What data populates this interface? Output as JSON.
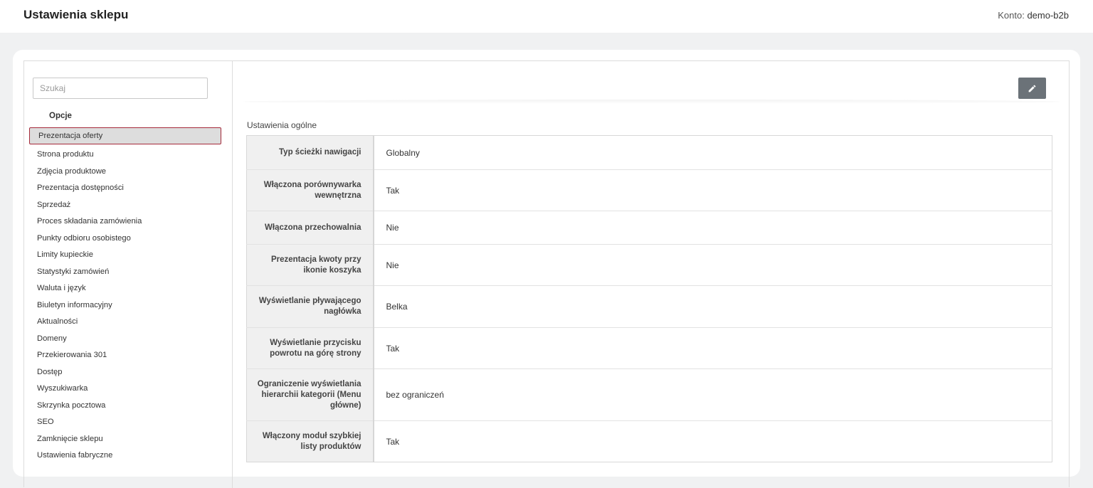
{
  "header": {
    "title": "Ustawienia sklepu",
    "account_label": "Konto:",
    "account_name": "demo-b2b"
  },
  "sidebar": {
    "search_placeholder": "Szukaj",
    "heading": "Opcje",
    "items": [
      {
        "label": "Prezentacja oferty",
        "active": true
      },
      {
        "label": "Strona produktu"
      },
      {
        "label": "Zdjęcia produktowe"
      },
      {
        "label": "Prezentacja dostępności"
      },
      {
        "label": "Sprzedaż"
      },
      {
        "label": "Proces składania zamówienia"
      },
      {
        "label": "Punkty odbioru osobistego"
      },
      {
        "label": "Limity kupieckie"
      },
      {
        "label": "Statystyki zamówień"
      },
      {
        "label": "Waluta i język"
      },
      {
        "label": "Biuletyn informacyjny"
      },
      {
        "label": "Aktualności"
      },
      {
        "label": "Domeny"
      },
      {
        "label": "Przekierowania 301"
      },
      {
        "label": "Dostęp"
      },
      {
        "label": "Wyszukiwarka"
      },
      {
        "label": "Skrzynka pocztowa"
      },
      {
        "label": "SEO"
      },
      {
        "label": "Zamknięcie sklepu"
      },
      {
        "label": "Ustawienia fabryczne"
      }
    ]
  },
  "content": {
    "edit_icon": "pencil-icon",
    "section_title": "Ustawienia ogólne",
    "rows": [
      {
        "label": "Typ ścieżki nawigacji",
        "value": "Globalny"
      },
      {
        "label": "Włączona porównywarka wewnętrzna",
        "value": "Tak"
      },
      {
        "label": "Włączona przechowalnia",
        "value": "Nie"
      },
      {
        "label": "Prezentacja kwoty przy ikonie koszyka",
        "value": "Nie"
      },
      {
        "label": "Wyświetlanie pływającego nagłówka",
        "value": "Belka"
      },
      {
        "label": "Wyświetlanie przycisku powrotu na górę strony",
        "value": "Tak"
      },
      {
        "label": "Ograniczenie wyświetlania hierarchii kategorii (Menu główne)",
        "value": "bez ograniczeń"
      },
      {
        "label": "Włączony moduł szybkiej listy produktów",
        "value": "Tak"
      }
    ]
  },
  "colors": {
    "active_border": "#a52a3a",
    "edit_button": "#6b7278",
    "background": "#f0f1f2"
  }
}
